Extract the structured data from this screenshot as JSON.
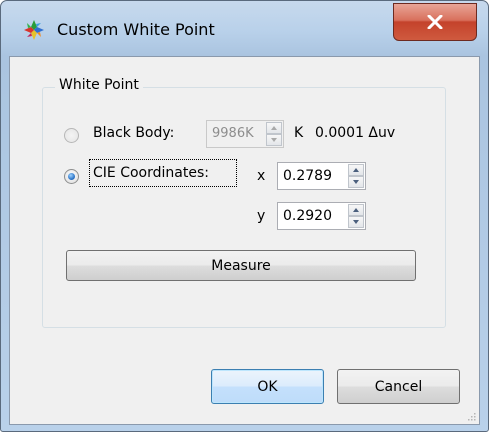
{
  "window": {
    "title": "Custom White Point",
    "close_glyph": "X"
  },
  "group": {
    "title": "White Point"
  },
  "black_body": {
    "label": "Black Body:",
    "selected": false,
    "temperature_value": "9986K",
    "unit": "K",
    "delta_uv": "0.0001 Δuv"
  },
  "cie": {
    "label": "CIE Coordinates:",
    "selected": true,
    "x_label": "x",
    "x_value": "0.2789",
    "y_label": "y",
    "y_value": "0.2920"
  },
  "buttons": {
    "measure": "Measure",
    "ok": "OK",
    "cancel": "Cancel"
  },
  "icons": {
    "app": "color-wheel-icon",
    "close": "close-icon",
    "spin_up": "spin-up-icon",
    "spin_down": "spin-down-icon",
    "resize": "resize-grip-icon"
  }
}
